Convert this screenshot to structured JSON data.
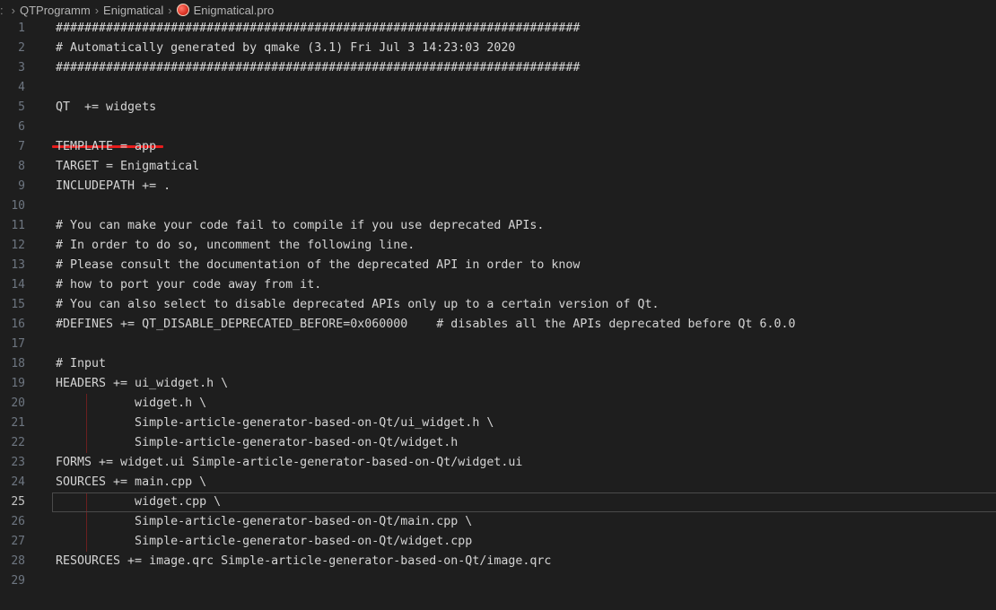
{
  "breadcrumb": {
    "lead": ":",
    "items": [
      {
        "label": "QTProgramm"
      },
      {
        "label": "Enigmatical"
      },
      {
        "label": "Enigmatical.pro"
      }
    ]
  },
  "editor": {
    "current_line": 25,
    "lines": [
      {
        "n": "1",
        "text": "#########################################################################"
      },
      {
        "n": "2",
        "text": "# Automatically generated by qmake (3.1) Fri Jul 3 14:23:03 2020"
      },
      {
        "n": "3",
        "text": "#########################################################################"
      },
      {
        "n": "4",
        "text": ""
      },
      {
        "n": "5",
        "text": "QT  += widgets"
      },
      {
        "n": "6",
        "text": ""
      },
      {
        "n": "7",
        "text": "TEMPLATE = app"
      },
      {
        "n": "8",
        "text": "TARGET = Enigmatical"
      },
      {
        "n": "9",
        "text": "INCLUDEPATH += ."
      },
      {
        "n": "10",
        "text": ""
      },
      {
        "n": "11",
        "text": "# You can make your code fail to compile if you use deprecated APIs."
      },
      {
        "n": "12",
        "text": "# In order to do so, uncomment the following line."
      },
      {
        "n": "13",
        "text": "# Please consult the documentation of the deprecated API in order to know"
      },
      {
        "n": "14",
        "text": "# how to port your code away from it."
      },
      {
        "n": "15",
        "text": "# You can also select to disable deprecated APIs only up to a certain version of Qt."
      },
      {
        "n": "16",
        "text": "#DEFINES += QT_DISABLE_DEPRECATED_BEFORE=0x060000    # disables all the APIs deprecated before Qt 6.0.0"
      },
      {
        "n": "17",
        "text": ""
      },
      {
        "n": "18",
        "text": "# Input"
      },
      {
        "n": "19",
        "text": "HEADERS += ui_widget.h \\"
      },
      {
        "n": "20",
        "text": "           widget.h \\"
      },
      {
        "n": "21",
        "text": "           Simple-article-generator-based-on-Qt/ui_widget.h \\"
      },
      {
        "n": "22",
        "text": "           Simple-article-generator-based-on-Qt/widget.h"
      },
      {
        "n": "23",
        "text": "FORMS += widget.ui Simple-article-generator-based-on-Qt/widget.ui"
      },
      {
        "n": "24",
        "text": "SOURCES += main.cpp \\"
      },
      {
        "n": "25",
        "text": "           widget.cpp \\"
      },
      {
        "n": "26",
        "text": "           Simple-article-generator-based-on-Qt/main.cpp \\"
      },
      {
        "n": "27",
        "text": "           Simple-article-generator-based-on-Qt/widget.cpp"
      },
      {
        "n": "28",
        "text": "RESOURCES += image.qrc Simple-article-generator-based-on-Qt/image.qrc"
      },
      {
        "n": "29",
        "text": ""
      }
    ]
  },
  "colors": {
    "background": "#1e1e1e",
    "text": "#d4d4d4",
    "line_number": "#6e7681",
    "annotation_underline": "#e81c1c"
  }
}
